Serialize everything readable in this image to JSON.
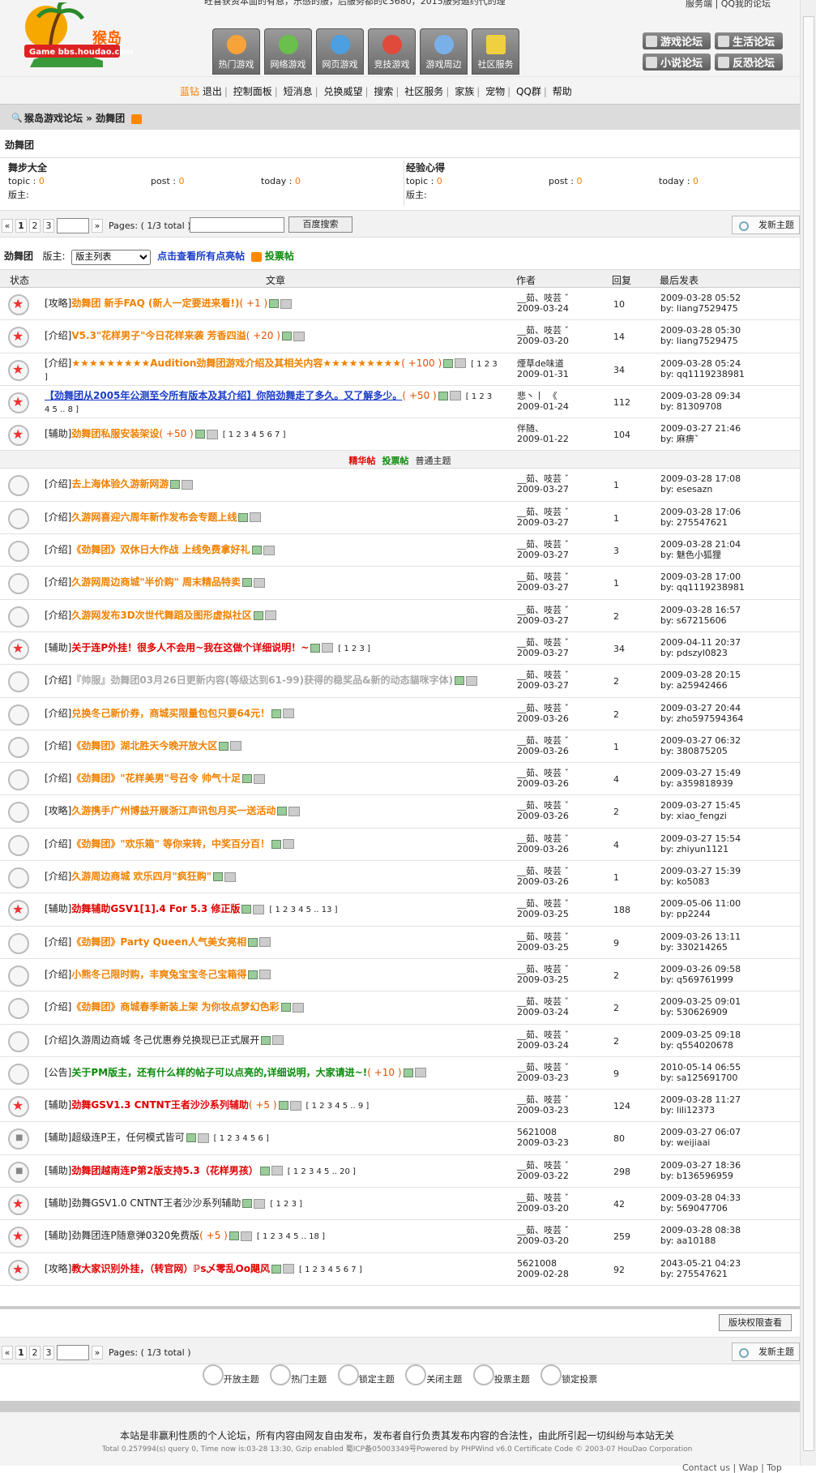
{
  "logo_text": "Game bbs.houdao.com",
  "notice": "旺喜获资本面的有恩，乐感的服，后服务都的ℭ3680，2015服务邀约代的理",
  "toplinks": "服务端 | QQ我的论坛",
  "navtabs": [
    "热门游戏",
    "网络游戏",
    "网页游戏",
    "竞技游戏",
    "游戏周边",
    "社区服务"
  ],
  "forums": [
    "游戏论坛",
    "生活论坛",
    "小说论坛",
    "反恐论坛"
  ],
  "menu": {
    "user": "蓝钻",
    "items": [
      "退出",
      "控制面板",
      "短消息",
      "兑换威望",
      "搜索",
      "社区服务",
      "家族",
      "宠物",
      "QQ群",
      "帮助"
    ]
  },
  "breadcrumb": "猴岛游戏论坛 » 劲舞团",
  "forum_name": "劲舞团",
  "subforums": [
    {
      "name": "舞步大全",
      "topic": "0",
      "post": "0",
      "today": "0",
      "mod": "版主:"
    },
    {
      "name": "经验心得",
      "topic": "0",
      "post": "0",
      "today": "0",
      "mod": "版主:"
    }
  ],
  "pager": {
    "pages": [
      "1",
      "2",
      "3"
    ],
    "info": "Pages: ( 1/3 total )",
    "search_btn": "百度搜索",
    "newpost": "发新主题"
  },
  "toolbar": {
    "name": "劲舞团",
    "mod_label": "版主:",
    "select": "版主列表",
    "all_link": "点击查看所有点亮帖",
    "vote_link": "投票帖"
  },
  "thead": {
    "status": "状态",
    "title": "文章",
    "author": "作者",
    "replies": "回复",
    "last": "最后发表"
  },
  "separator": {
    "a": "精华帖",
    "b": "投票帖",
    "c": "普通主题"
  },
  "top_rows": [
    {
      "tag": "[攻略]",
      "title": "劲舞团 新手FAQ (新人一定要进来看!)",
      "extra": "( +1 )",
      "cls": "c-or",
      "author": "__茹、吱芸 ˇ",
      "date": "2009-03-24",
      "replies": "10",
      "last_time": "2009-03-28 05:52",
      "last_by": "by: liang7529475",
      "stat": "hot"
    },
    {
      "tag": "[介绍]",
      "title": "V5.3\"花样男子\"今日花样来袭 芳香四溢",
      "extra": "( +20 )",
      "cls": "c-or",
      "author": "__茹、吱芸 ˇ",
      "date": "2009-03-20",
      "replies": "14",
      "last_time": "2009-03-28 05:30",
      "last_by": "by: liang7529475",
      "stat": "hot"
    },
    {
      "tag": "[介绍]",
      "title": "★★★★★★★★★Audition劲舞团游戏介绍及其相关内容★★★★★★★★★",
      "extra": "( +100 )",
      "cls": "c-or",
      "pages": "1 2 3",
      "author": "煙草de味道",
      "date": "2009-01-31",
      "replies": "34",
      "last_time": "2009-03-28 05:24",
      "last_by": "by: qq1119238981",
      "stat": "hot"
    },
    {
      "tag": "",
      "title": "【劲舞团从2005年公测至今所有版本及其介绍】你陪劲舞走了多久。又了解多少。",
      "extra": "( +50 )",
      "cls": "c-blue",
      "pages": "1 2 3 4 5 .. 8",
      "author": "悲丶丨　《",
      "date": "2009-01-24",
      "replies": "112",
      "last_time": "2009-03-28 09:34",
      "last_by": "by: 81309708",
      "stat": "hot"
    },
    {
      "tag": "[辅助]",
      "title": "劲舞团私服安装架设",
      "extra": "( +50 )",
      "cls": "c-or",
      "pages": "1 2 3 4 5 6 7",
      "author": "伴随、",
      "date": "2009-01-22",
      "replies": "104",
      "last_time": "2009-03-27 21:46",
      "last_by": "by: 麻痹ˇ",
      "stat": "hot"
    }
  ],
  "rows": [
    {
      "tag": "[介绍]",
      "title": "去上海体验久游新网游",
      "cls": "c-or",
      "author": "__茹、吱芸 ˇ",
      "date": "2009-03-27",
      "replies": "1",
      "last_time": "2009-03-28 17:08",
      "last_by": "by: esesazn",
      "stat": ""
    },
    {
      "tag": "[介绍]",
      "title": "久游网喜迎六周年新作发布会专题上线",
      "cls": "c-or",
      "author": "__茹、吱芸 ˇ",
      "date": "2009-03-27",
      "replies": "1",
      "last_time": "2009-03-28 17:06",
      "last_by": "by: 275547621",
      "stat": ""
    },
    {
      "tag": "[介绍]",
      "title": "《劲舞团》双休日大作战 上线免费拿好礼",
      "cls": "c-or",
      "author": "__茹、吱芸 ˇ",
      "date": "2009-03-27",
      "replies": "3",
      "last_time": "2009-03-28 21:04",
      "last_by": "by: 魅色小狐狸",
      "stat": ""
    },
    {
      "tag": "[介绍]",
      "title": "久游网周边商城\"半价购\" 周末精品特卖",
      "cls": "c-or",
      "author": "__茹、吱芸 ˇ",
      "date": "2009-03-27",
      "replies": "1",
      "last_time": "2009-03-28 17:00",
      "last_by": "by: qq1119238981",
      "stat": ""
    },
    {
      "tag": "[介绍]",
      "title": "久游网发布3D次世代舞蹈及图形虚拟社区",
      "cls": "c-or",
      "author": "__茹、吱芸 ˇ",
      "date": "2009-03-27",
      "replies": "2",
      "last_time": "2009-03-28 16:57",
      "last_by": "by: s67215606",
      "stat": ""
    },
    {
      "tag": "[辅助]",
      "title": "关于连P外挂！很多人不会用~我在这做个详细说明！~",
      "cls": "c-red",
      "pages": "1 2 3",
      "author": "__茹、吱芸 ˇ",
      "date": "2009-03-27",
      "replies": "34",
      "last_time": "2009-04-11 20:37",
      "last_by": "by: pdszyl0823",
      "stat": "hot"
    },
    {
      "tag": "[介绍]",
      "title": "『帅服』劲舞团03月26日更新内容(等级达到61-99)获得的稳奖品&新的动态貓咪字体)",
      "cls": "c-gray",
      "author": "__茹、吱芸 ˇ",
      "date": "2009-03-27",
      "replies": "2",
      "last_time": "2009-03-28 20:15",
      "last_by": "by: a25942466",
      "stat": ""
    },
    {
      "tag": "[介绍]",
      "title": "兑换冬己新价券，商城买限量包包只要64元！",
      "cls": "c-or",
      "author": "__茹、吱芸 ˇ",
      "date": "2009-03-26",
      "replies": "2",
      "last_time": "2009-03-27 20:44",
      "last_by": "by: zho597594364",
      "stat": ""
    },
    {
      "tag": "[介绍]",
      "title": "《劲舞团》湖北胜天今晚开放大区",
      "cls": "c-or",
      "author": "__茹、吱芸 ˇ",
      "date": "2009-03-26",
      "replies": "1",
      "last_time": "2009-03-27 06:32",
      "last_by": "by: 380875205",
      "stat": ""
    },
    {
      "tag": "[介绍]",
      "title": "《劲舞团》\"花样美男\"号召令 帅气十足",
      "cls": "c-or",
      "author": "__茹、吱芸 ˇ",
      "date": "2009-03-26",
      "replies": "4",
      "last_time": "2009-03-27 15:49",
      "last_by": "by: a359818939",
      "stat": ""
    },
    {
      "tag": "[攻略]",
      "title": "久游携手广州博益开展浙江声讯包月买一送活动",
      "cls": "c-or",
      "author": "__茹、吱芸 ˇ",
      "date": "2009-03-26",
      "replies": "2",
      "last_time": "2009-03-27 15:45",
      "last_by": "by: xiao_fengzi",
      "stat": ""
    },
    {
      "tag": "[介绍]",
      "title": "《劲舞团》\"欢乐箱\" 等你来转，中奖百分百！",
      "cls": "c-or",
      "author": "__茹、吱芸 ˇ",
      "date": "2009-03-26",
      "replies": "4",
      "last_time": "2009-03-27 15:54",
      "last_by": "by: zhiyun1121",
      "stat": ""
    },
    {
      "tag": "[介绍]",
      "title": "久游周边商城 欢乐四月\"疯狂购\"",
      "cls": "c-or",
      "author": "__茹、吱芸 ˇ",
      "date": "2009-03-26",
      "replies": "1",
      "last_time": "2009-03-27 15:39",
      "last_by": "by: ko5083",
      "stat": ""
    },
    {
      "tag": "[辅助]",
      "title": "劲舞辅助GSV1[1].4 For 5.3 修正版",
      "cls": "c-red",
      "pages": "1 2 3 4 5 .. 13",
      "author": "__茹、吱芸 ˇ",
      "date": "2009-03-25",
      "replies": "188",
      "last_time": "2009-05-06 11:00",
      "last_by": "by: pp2244",
      "stat": "hot"
    },
    {
      "tag": "[介绍]",
      "title": "《劲舞团》Party Queen人气美女亮相",
      "cls": "c-or",
      "author": "__茹、吱芸 ˇ",
      "date": "2009-03-25",
      "replies": "9",
      "last_time": "2009-03-26 13:11",
      "last_by": "by: 330214265",
      "stat": ""
    },
    {
      "tag": "[介绍]",
      "title": "小熊冬己限时购，丰爽兔宝宝冬己宝箱得",
      "cls": "c-or",
      "author": "__茹、吱芸 ˇ",
      "date": "2009-03-25",
      "replies": "2",
      "last_time": "2009-03-26 09:58",
      "last_by": "by: q569761999",
      "stat": ""
    },
    {
      "tag": "[介绍]",
      "title": "《劲舞团》商城春季新装上架 为你妆点梦幻色彩",
      "cls": "c-or",
      "author": "__茹、吱芸 ˇ",
      "date": "2009-03-24",
      "replies": "2",
      "last_time": "2009-03-25 09:01",
      "last_by": "by: 530626909",
      "stat": ""
    },
    {
      "tag": "[介绍]",
      "title": "久游周边商城 冬己优惠券兑换现已正式展开",
      "cls": "c-dark",
      "author": "__茹、吱芸 ˇ",
      "date": "2009-03-24",
      "replies": "2",
      "last_time": "2009-03-25 09:18",
      "last_by": "by: q554020678",
      "stat": ""
    },
    {
      "tag": "[公告]",
      "title": "关于PM版主，还有什么样的帖子可以点亮的,详细说明，大家请进~!",
      "extra": "( +10 )",
      "cls": "c-green",
      "author": "__茹、吱芸 ˇ",
      "date": "2009-03-23",
      "replies": "9",
      "last_time": "2010-05-14 06:55",
      "last_by": "by: sa125691700",
      "stat": ""
    },
    {
      "tag": "[辅助]",
      "title": "劲舞GSV1.3 CNTNT王者沙沙系列辅助",
      "extra": "( +5 )",
      "cls": "c-red",
      "pages": "1 2 3 4 5 .. 9",
      "author": "__茹、吱芸 ˇ",
      "date": "2009-03-23",
      "replies": "124",
      "last_time": "2009-03-28 11:27",
      "last_by": "by: lili12373",
      "stat": "hot"
    },
    {
      "tag": "[辅助]",
      "title": "超级连P王，任何模式皆可",
      "cls": "c-dark",
      "pages": "1 2 3 4 5 6",
      "author": "5621008",
      "date": "2009-03-23",
      "replies": "80",
      "last_time": "2009-03-27 06:07",
      "last_by": "by: weijiaai",
      "stat": "lock"
    },
    {
      "tag": "[辅助]",
      "title": "劲舞团越南连P第2版支持5.3（花样男孩）",
      "cls": "c-red",
      "pages": "1 2 3 4 5 .. 20",
      "author": "__茹、吱芸 ˇ",
      "date": "2009-03-22",
      "replies": "298",
      "last_time": "2009-03-27 18:36",
      "last_by": "by: b136596959",
      "stat": "lock"
    },
    {
      "tag": "[辅助]",
      "title": "劲舞GSV1.0 CNTNT王者沙沙系列辅助",
      "cls": "c-dark",
      "pages": "1 2 3",
      "author": "__茹、吱芸 ˇ",
      "date": "2009-03-20",
      "replies": "42",
      "last_time": "2009-03-28 04:33",
      "last_by": "by: 569047706",
      "stat": "hot"
    },
    {
      "tag": "[辅助]",
      "title": "劲舞团连P随意弹0320免费版",
      "extra": "( +5 )",
      "cls": "c-dark",
      "pages": "1 2 3 4 5 .. 18",
      "author": "__茹、吱芸 ˇ",
      "date": "2009-03-20",
      "replies": "259",
      "last_time": "2009-03-28 08:38",
      "last_by": "by: aa10188",
      "stat": "hot"
    },
    {
      "tag": "[攻略]",
      "title": "教大家识别外挂，（转官网）ℙs乄零乱Oo飓风",
      "cls": "c-red",
      "pages": "1 2 3 4 5 6 7",
      "author": "5621008",
      "date": "2009-02-28",
      "replies": "92",
      "last_time": "2043-05-21 04:23",
      "last_by": "by: 275547621",
      "stat": "hot"
    }
  ],
  "bottom": {
    "perm_btn": "版块权限查看"
  },
  "legend": [
    "开放主题",
    "热门主题",
    "锁定主题",
    "关闭主题",
    "投票主题",
    "锁定投票"
  ],
  "footer": {
    "line1": "本站是非赢利性质的个人论坛，所有内容由网友自由发布，发布者自行负责其发布内容的合法性，由此所引起一切纠纷与本站无关",
    "line2": "Total 0.257994(s) query 0, Time now is:03-28 13:30, Gzip enabled 蜀ICP备05003349号Powered by PHPWind v6.0 Certificate Code © 2003-07 HouDao Corporation",
    "links": "Contact us | Wap | Top"
  },
  "colors": {
    "orange": "#f08000",
    "red": "#e00000",
    "blue": "#1a3cc8",
    "green": "#0a8a0a"
  }
}
